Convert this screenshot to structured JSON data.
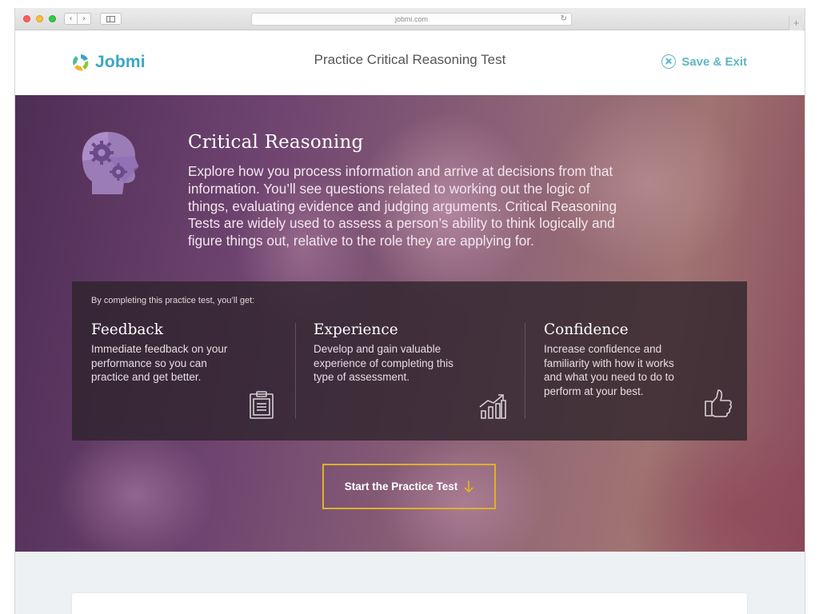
{
  "browser": {
    "url": "jobmi.com"
  },
  "header": {
    "logo_text": "Jobmi",
    "page_title": "Practice Critical Reasoning Test",
    "save_exit_label": "Save & Exit"
  },
  "hero": {
    "title": "Critical Reasoning",
    "description": "Explore how you process information and arrive at decisions from that information. You’ll see questions related to working out the logic of things, evaluating evidence and judging arguments. Critical Reasoning Tests are widely used to assess a person’s ability to think logically and figure things out, relative to the role they are applying for.",
    "benefits_intro": "By completing this practice test, you’ll get:",
    "benefits": [
      {
        "title": "Feedback",
        "text": "Immediate feedback on your performance so you can practice and get better.",
        "icon": "clipboard-icon"
      },
      {
        "title": "Experience",
        "text": "Develop and gain valuable experience of completing this type of assessment.",
        "icon": "growth-chart-icon"
      },
      {
        "title": "Confidence",
        "text": "Increase confidence and familiarity with how it works and what you need to do to perform at your best.",
        "icon": "thumbs-up-icon"
      }
    ],
    "cta_label": "Start the Practice Test"
  },
  "colors": {
    "brand": "#3aa6c4",
    "accent": "#5fb7c5",
    "cta_border": "#e0b02a"
  }
}
